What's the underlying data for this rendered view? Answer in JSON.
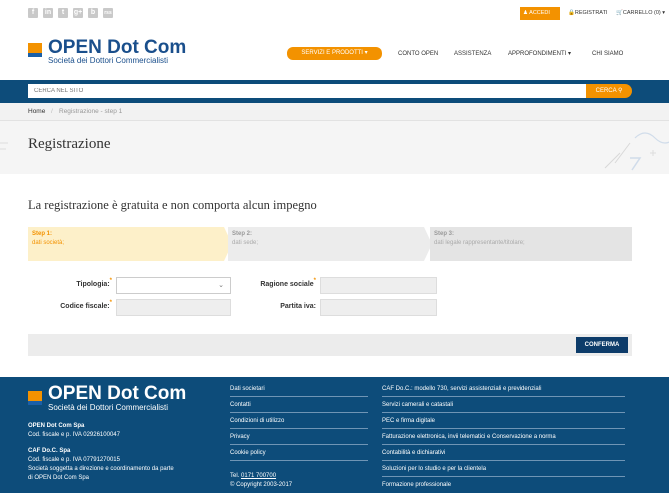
{
  "topbar": {
    "social": [
      "f",
      "in",
      "t",
      "g+",
      "b",
      "rss"
    ],
    "accedi": "ACCEDI",
    "registrati": "REGISTRATI",
    "carrello": "CARRELLO (0) ▾"
  },
  "header": {
    "logo_title": "OPEN Dot Com",
    "logo_subtitle": "Società dei Dottori Commercialisti",
    "nav": [
      "SERVIZI E PRODOTTI ▾",
      "CONTO OPEN",
      "ASSISTENZA",
      "APPROFONDIMENTI ▾",
      "CHI SIAMO"
    ]
  },
  "search": {
    "placeholder": "CERCA NEL SITO",
    "button": "CERCA"
  },
  "breadcrumb": {
    "home": "Home",
    "sep": "/",
    "current": "Registrazione - step 1"
  },
  "page": {
    "title": "Registrazione",
    "subtitle": "La registrazione è gratuita e non comporta alcun impegno"
  },
  "steps": [
    {
      "title": "Step 1:",
      "desc": "dati società;"
    },
    {
      "title": "Step 2:",
      "desc": "dati sede;"
    },
    {
      "title": "Step 3:",
      "desc": "dati legale rappresentante/titolare;"
    }
  ],
  "form": {
    "tipologia": "Tipologia:",
    "ragione_sociale": "Ragione sociale",
    "codice_fiscale": "Codice fiscale:",
    "partita_iva": "Partita iva:",
    "required_mark": "*",
    "conferma": "CONFERMA"
  },
  "footer": {
    "logo_title": "OPEN Dot Com",
    "logo_subtitle": "Società dei Dottori Commercialisti",
    "c1_name": "OPEN Dot Com Spa",
    "c1_cf": "Cod. fiscale e p. IVA 02926100047",
    "c2_name": "CAF Do.C. Spa",
    "c2_cf": "Cod. fiscale e p. IVA 07791270015",
    "c2_note1": "Società soggetta a direzione e coordinamento da parte",
    "c2_note2": "di OPEN Dot Com Spa",
    "links": [
      "Dati societari",
      "Contatti",
      "Condizioni di utilizzo",
      "Privacy",
      "Cookie policy"
    ],
    "tel_prefix": "Tel. ",
    "tel": "0171 700700",
    "copyright": "© Copyright 2003-2017",
    "services": [
      "CAF Do.C.: modello 730, servizi assistenziali e previdenziali",
      "Servizi camerali e catastali",
      "PEC e firma digitale",
      "Fatturazione elettronica, invii telematici e Conservazione a norma",
      "Contabilità e dichiarativi",
      "Soluzioni per lo studio e per la clientela",
      "Formazione professionale"
    ]
  },
  "colors": {
    "accent": "#f39200",
    "primary": "#0d4c7a"
  }
}
